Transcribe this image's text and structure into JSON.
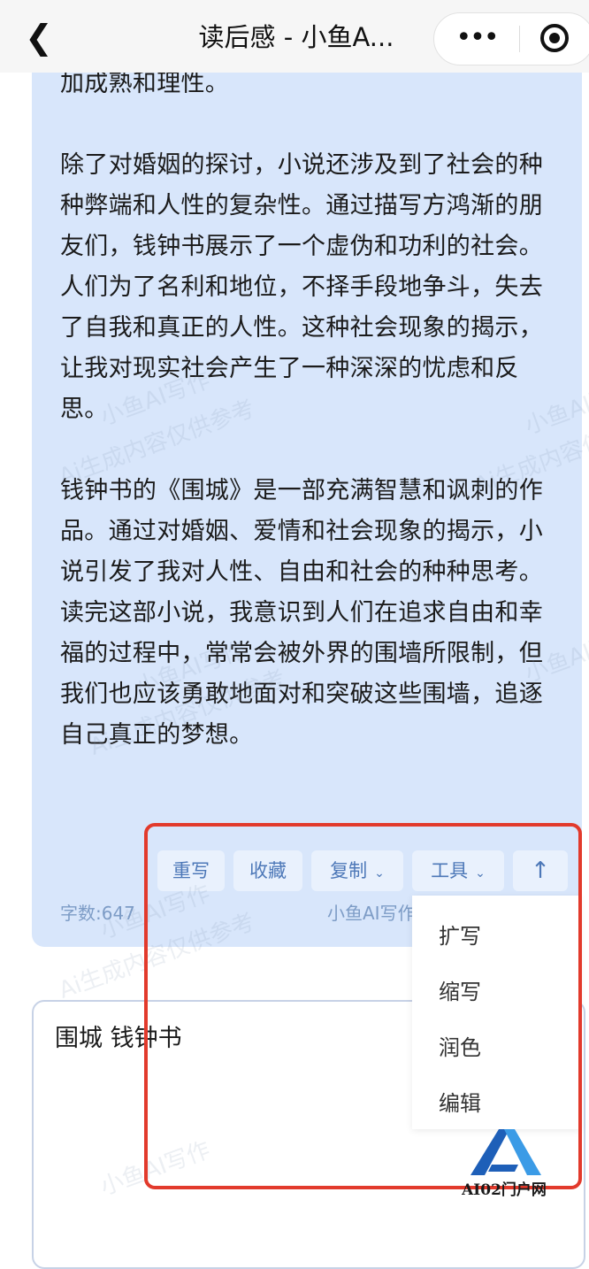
{
  "nav": {
    "back_glyph": "❮",
    "title": "读后感 - 小鱼A...",
    "more_glyph": "•••"
  },
  "answer": {
    "paragraphs": [
      "加成熟和理性。",
      "除了对婚姻的探讨，小说还涉及到了社会的种种弊端和人性的复杂性。通过描写方鸿渐的朋友们，钱钟书展示了一个虚伪和功利的社会。人们为了名利和地位，不择手段地争斗，失去了自我和真正的人性。这种社会现象的揭示，让我对现实社会产生了一种深深的忧虑和反思。",
      "钱钟书的《围城》是一部充满智慧和讽刺的作品。通过对婚姻、爱情和社会现象的揭示，小说引发了我对人性、自由和社会的种种思考。读完这部小说，我意识到人们在追求自由和幸福的过程中，常常会被外界的围墙所限制，但我们也应该勇敢地面对和突破这些围墙，追逐自己真正的梦想。"
    ],
    "actions": {
      "rewrite": "重写",
      "favorite": "收藏",
      "copy": "复制",
      "tools": "工具",
      "chevron": "⌄",
      "up": "↑"
    },
    "word_count": "字数:647",
    "brand_note": "小鱼AI写作"
  },
  "tools_menu": [
    "扩写",
    "缩写",
    "润色",
    "编辑"
  ],
  "input": {
    "value": "围城 钱钟书"
  },
  "watermarks": [
    "小鱼AI写作",
    "Ai生成内容仅供参考"
  ],
  "logo": {
    "text": "AI02门户网",
    "colors": [
      "#1e5fb8",
      "#3b9be6"
    ]
  },
  "colors": {
    "card_bg": "#d8e6fb",
    "button_bg": "#e9f1fd",
    "button_text": "#4d78b8",
    "highlight": "#e23a2c"
  }
}
